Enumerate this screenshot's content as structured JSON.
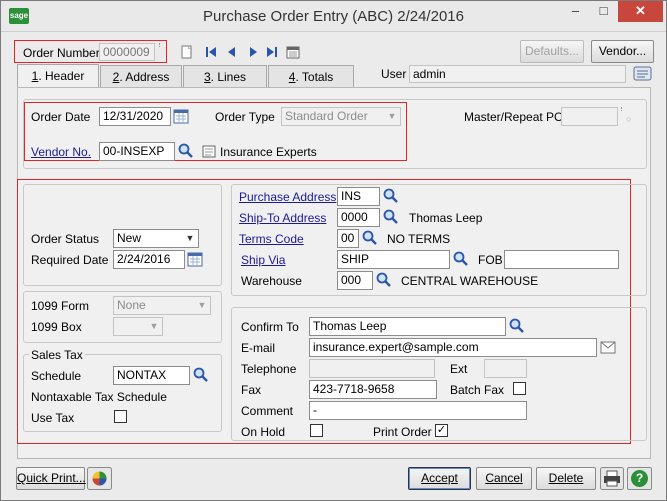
{
  "window": {
    "app_icon": "sage",
    "title": "Purchase Order Entry (ABC) 2/24/2016",
    "min": "–",
    "max": "□",
    "close": "✕"
  },
  "header": {
    "order_number_label": "Order Number",
    "order_number_value": "0000009",
    "defaults_label": "Defaults...",
    "vendor_label": "Vendor...",
    "user_label": "User",
    "user_value": "admin"
  },
  "tabs": [
    {
      "key": "1",
      "label": ". Header"
    },
    {
      "key": "2",
      "label": ". Address"
    },
    {
      "key": "3",
      "label": ". Lines"
    },
    {
      "key": "4",
      "label": ". Totals"
    }
  ],
  "order": {
    "order_date_label": "Order Date",
    "order_date_value": "12/31/2020",
    "order_type_label": "Order Type",
    "order_type_value": "Standard Order",
    "master_repeat_label": "Master/Repeat PO",
    "master_repeat_value": "",
    "vendor_no_label": "Vendor No.",
    "vendor_no_value": "00-INSEXP",
    "vendor_name": "Insurance Experts"
  },
  "status": {
    "order_status_label": "Order Status",
    "order_status_value": "New",
    "required_date_label": "Required Date",
    "required_date_value": "2/24/2016"
  },
  "form1099": {
    "form_label": "1099 Form",
    "form_value": "None",
    "box_label": "1099 Box",
    "box_value": ""
  },
  "sales_tax": {
    "group_label": "Sales Tax",
    "schedule_label": "Schedule",
    "schedule_value": "NONTAX",
    "schedule_desc": "Nontaxable Tax Schedule",
    "use_tax_label": "Use Tax"
  },
  "shipping": {
    "purchase_address_label": "Purchase Address",
    "purchase_address_value": "INS",
    "ship_to_label": "Ship-To Address",
    "ship_to_value": "0000",
    "ship_to_name": "Thomas Leep",
    "terms_label": "Terms Code",
    "terms_value": "00",
    "terms_desc": "NO TERMS",
    "ship_via_label": "Ship Via",
    "ship_via_value": "SHIP",
    "fob_label": "FOB",
    "fob_value": "",
    "warehouse_label": "Warehouse",
    "warehouse_value": "000",
    "warehouse_desc": "CENTRAL WAREHOUSE"
  },
  "contact": {
    "confirm_to_label": "Confirm To",
    "confirm_to_value": "Thomas Leep",
    "email_label": "E-mail",
    "email_value": "insurance.expert@sample.com",
    "telephone_label": "Telephone",
    "telephone_value": "",
    "ext_label": "Ext",
    "ext_value": "",
    "fax_label": "Fax",
    "fax_value": "423-7718-9658",
    "batch_fax_label": "Batch Fax",
    "comment_label": "Comment",
    "comment_value": "-",
    "on_hold_label": "On Hold",
    "print_order_label": "Print Order",
    "print_order_check": "✓"
  },
  "footer": {
    "quick_print_label": "Quick Print...",
    "accept_label": "Accept",
    "cancel_label": "Cancel",
    "delete_label": "Delete",
    "help_label": "?"
  }
}
